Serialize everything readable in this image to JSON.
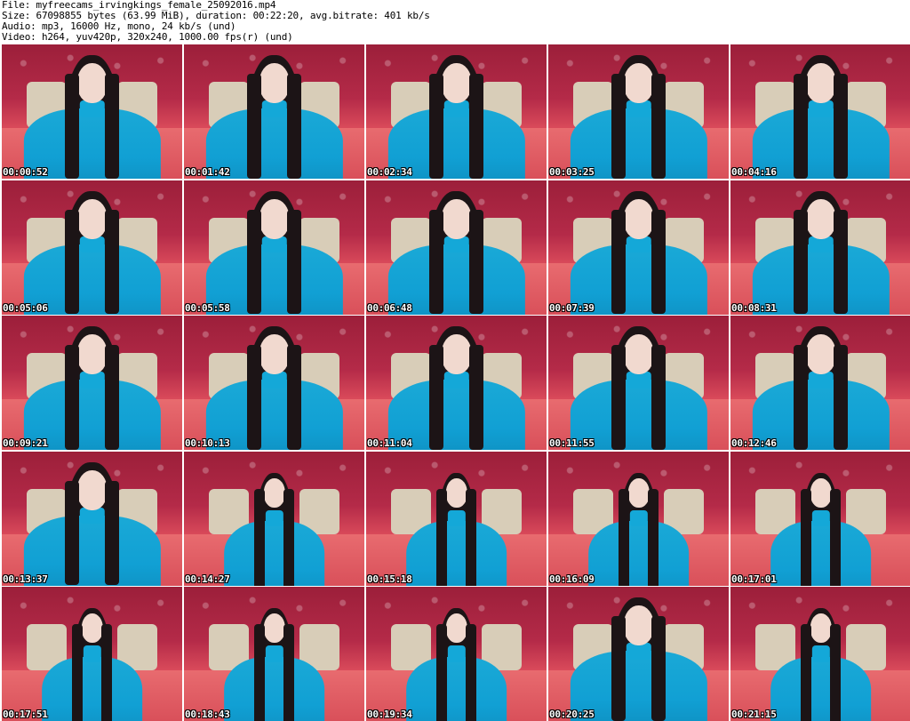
{
  "header": {
    "file": "File: myfreecams_irvingkings_female_25092016.mp4",
    "size": "Size: 67098855 bytes (63.99 MiB), duration: 00:22:20, avg.bitrate: 401 kb/s",
    "audio": "Audio: mp3, 16000 Hz, mono, 24 kb/s (und)",
    "video": "Video: h264, yuv420p, 320x240, 1000.00 fps(r) (und)"
  },
  "thumbnails": [
    {
      "timestamp": "00:00:52",
      "far": false
    },
    {
      "timestamp": "00:01:42",
      "far": false
    },
    {
      "timestamp": "00:02:34",
      "far": false
    },
    {
      "timestamp": "00:03:25",
      "far": false
    },
    {
      "timestamp": "00:04:16",
      "far": false
    },
    {
      "timestamp": "00:05:06",
      "far": false
    },
    {
      "timestamp": "00:05:58",
      "far": false
    },
    {
      "timestamp": "00:06:48",
      "far": false
    },
    {
      "timestamp": "00:07:39",
      "far": false
    },
    {
      "timestamp": "00:08:31",
      "far": false
    },
    {
      "timestamp": "00:09:21",
      "far": false
    },
    {
      "timestamp": "00:10:13",
      "far": false
    },
    {
      "timestamp": "00:11:04",
      "far": false
    },
    {
      "timestamp": "00:11:55",
      "far": false
    },
    {
      "timestamp": "00:12:46",
      "far": false
    },
    {
      "timestamp": "00:13:37",
      "far": false
    },
    {
      "timestamp": "00:14:27",
      "far": true
    },
    {
      "timestamp": "00:15:18",
      "far": true
    },
    {
      "timestamp": "00:16:09",
      "far": true
    },
    {
      "timestamp": "00:17:01",
      "far": true
    },
    {
      "timestamp": "00:17:51",
      "far": true
    },
    {
      "timestamp": "00:18:43",
      "far": true
    },
    {
      "timestamp": "00:19:34",
      "far": true
    },
    {
      "timestamp": "00:20:25",
      "far": false
    },
    {
      "timestamp": "00:21:15",
      "far": true
    }
  ],
  "colors": {
    "background": "#ffffff",
    "text": "#000000",
    "timestamp_text": "#ffffff"
  }
}
